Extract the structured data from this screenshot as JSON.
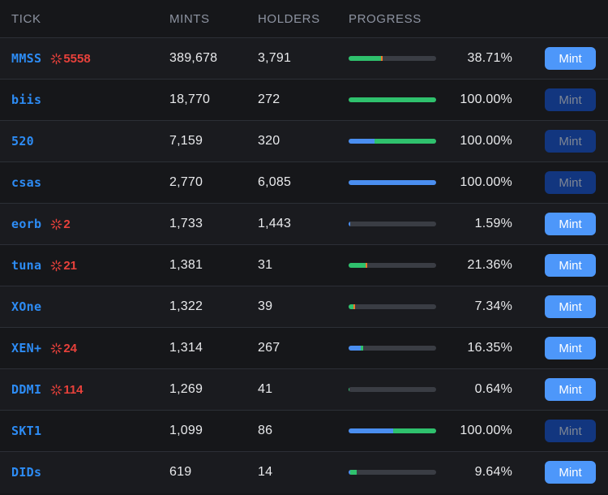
{
  "theme": {
    "page_bg": "#16171a",
    "row_bg": "#1a1b1f",
    "row_bg_alt": "#16171a",
    "divider": "#2c2f36",
    "header_text": "#8d93a1",
    "value_text": "#e9eaec",
    "tick_accent": "#2d8cf5",
    "badge_accent": "#e8413b",
    "bar_track": "#3a3d44",
    "bar_blue": "#4a8ef0",
    "bar_green": "#2fc16d",
    "bar_orange": "#f0772a",
    "button_enabled_bg": "#4d97fa",
    "button_enabled_text": "#ffffff",
    "button_disabled_bg": "#12367f",
    "button_disabled_text": "#7e8694"
  },
  "table": {
    "columns": [
      {
        "key": "tick",
        "label": "TICK"
      },
      {
        "key": "mints",
        "label": "MINTS"
      },
      {
        "key": "holders",
        "label": "HOLDERS"
      },
      {
        "key": "progress",
        "label": "PROGRESS"
      },
      {
        "key": "action",
        "label": ""
      }
    ],
    "action_label": "Mint",
    "action_label_disabled": "Mint",
    "badge_icon": "sparkle-icon",
    "rows": [
      {
        "tick": "MMSS",
        "badge": "5558",
        "mints": "389,678",
        "holders": "3,791",
        "progress_pct": "38.71%",
        "progress_value": 38.71,
        "bar_segments": [
          {
            "color": "green",
            "pct": 36.7
          },
          {
            "color": "orange",
            "pct": 2.0
          }
        ],
        "mint_enabled": true
      },
      {
        "tick": "biis",
        "badge": "",
        "mints": "18,770",
        "holders": "272",
        "progress_pct": "100.00%",
        "progress_value": 100.0,
        "bar_segments": [
          {
            "color": "green",
            "pct": 100
          }
        ],
        "mint_enabled": false
      },
      {
        "tick": "520",
        "badge": "",
        "mints": "7,159",
        "holders": "320",
        "progress_pct": "100.00%",
        "progress_value": 100.0,
        "bar_segments": [
          {
            "color": "blue",
            "pct": 30
          },
          {
            "color": "green",
            "pct": 70
          }
        ],
        "mint_enabled": false
      },
      {
        "tick": "csas",
        "badge": "",
        "mints": "2,770",
        "holders": "6,085",
        "progress_pct": "100.00%",
        "progress_value": 100.0,
        "bar_segments": [
          {
            "color": "blue",
            "pct": 100
          }
        ],
        "mint_enabled": false
      },
      {
        "tick": "eorb",
        "badge": "2",
        "mints": "1,733",
        "holders": "1,443",
        "progress_pct": "1.59%",
        "progress_value": 1.59,
        "bar_segments": [
          {
            "color": "blue",
            "pct": 1.59
          }
        ],
        "mint_enabled": true
      },
      {
        "tick": "tuna",
        "badge": "21",
        "mints": "1,381",
        "holders": "31",
        "progress_pct": "21.36%",
        "progress_value": 21.36,
        "bar_segments": [
          {
            "color": "green",
            "pct": 19.4
          },
          {
            "color": "orange",
            "pct": 2.0
          }
        ],
        "mint_enabled": true
      },
      {
        "tick": "XOne",
        "badge": "",
        "mints": "1,322",
        "holders": "39",
        "progress_pct": "7.34%",
        "progress_value": 7.34,
        "bar_segments": [
          {
            "color": "green",
            "pct": 5.3
          },
          {
            "color": "orange",
            "pct": 2.0
          }
        ],
        "mint_enabled": true
      },
      {
        "tick": "XEN+",
        "badge": "24",
        "mints": "1,314",
        "holders": "267",
        "progress_pct": "16.35%",
        "progress_value": 16.35,
        "bar_segments": [
          {
            "color": "blue",
            "pct": 14.3
          },
          {
            "color": "green",
            "pct": 2.0
          }
        ],
        "mint_enabled": true
      },
      {
        "tick": "DDMI",
        "badge": "114",
        "mints": "1,269",
        "holders": "41",
        "progress_pct": "0.64%",
        "progress_value": 0.64,
        "bar_segments": [
          {
            "color": "green",
            "pct": 0.64
          }
        ],
        "mint_enabled": true
      },
      {
        "tick": "SKT1",
        "badge": "",
        "mints": "1,099",
        "holders": "86",
        "progress_pct": "100.00%",
        "progress_value": 100.0,
        "bar_segments": [
          {
            "color": "blue",
            "pct": 51
          },
          {
            "color": "green",
            "pct": 49
          }
        ],
        "mint_enabled": false
      },
      {
        "tick": "DIDs",
        "badge": "",
        "mints": "619",
        "holders": "14",
        "progress_pct": "9.64%",
        "progress_value": 9.64,
        "bar_segments": [
          {
            "color": "blue",
            "pct": 2.0
          },
          {
            "color": "green",
            "pct": 7.6
          }
        ],
        "mint_enabled": true
      }
    ]
  }
}
